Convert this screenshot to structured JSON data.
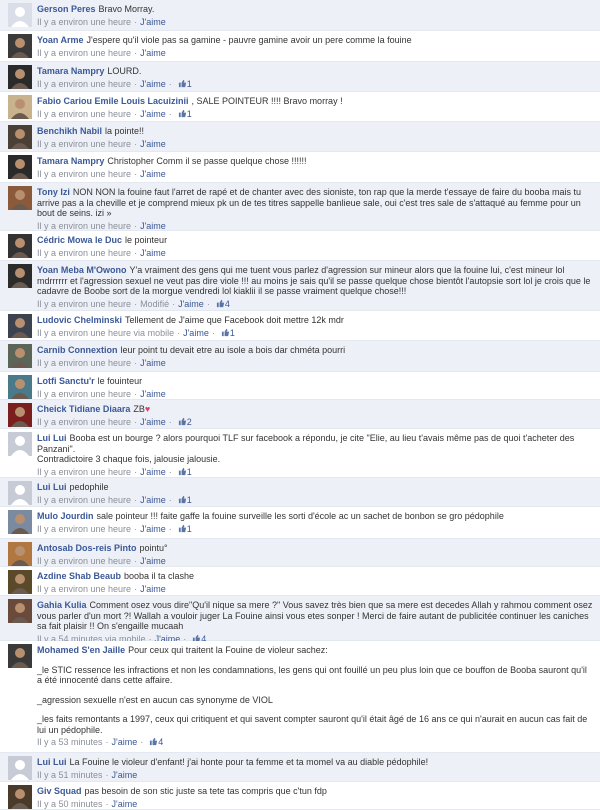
{
  "ui": {
    "like": "J'aime",
    "dot": "·"
  },
  "comments": [
    {
      "name": "Gerson Peres",
      "text": "Bravo Morray.",
      "time": "Il y a environ une heure",
      "avatar": "#d9dee8"
    },
    {
      "name": "Yoan Arme",
      "text": "J'espere qu'il viole pas sa gamine - pauvre gamine avoir un pere comme la fouine",
      "time": "Il y a environ une heure",
      "avatar": "#3a3a3a"
    },
    {
      "name": "Tamara Nampry",
      "text": "LOURD.",
      "time": "Il y a environ une heure",
      "likes": "1",
      "avatar": "#2a2a2a"
    },
    {
      "name": "Fabio Cariou Emile Louis Lacuizinii",
      "text": ", SALE POINTEUR !!!! Bravo morray !",
      "time": "Il y a environ une heure",
      "likes": "1",
      "avatar": "#c9b28e"
    },
    {
      "name": "Benchikh Nabil",
      "text": "la pointe!!",
      "time": "Il y a environ une heure",
      "avatar": "#4a4036"
    },
    {
      "name": "Tamara Nampry",
      "text": "Christopher Comm il se passe quelque chose !!!!!!",
      "time": "Il y a environ une heure",
      "avatar": "#2a2a2a"
    },
    {
      "name": "Tony Izi",
      "text": "NON NON la fouine faut l'arret de rapé et de chanter avec des sioniste, ton rap que la merde t'essaye de faire du booba mais tu arrive pas a la cheville et je comprend mieux pk un de tes titres sappelle banlieue sale, oui c'est tres sale de s'attaqué au femme pour un bout de seins. izi »",
      "time": "Il y a environ une heure",
      "avatar": "#8a5a3a"
    },
    {
      "name": "Cédric Mowa le Duc",
      "text": "le pointeur",
      "time": "Il y a environ une heure",
      "avatar": "#333333"
    },
    {
      "name": "Yoan Meba M'Owono",
      "text": "Y'a vraiment des gens qui me tuent vous parlez d'agression sur mineur alors que la fouine lui, c'est mineur lol mdrrrrrr et l'agression sexuel ne veut pas dire viole !!! au moins je sais qu'il se passe quelque chose bientôt l'autopsie sort lol je crois que le cadavre de Boobe sort de la morgue vendredi lol kiaklii il se passe vraiment quelque chose!!!",
      "time": "Il y a environ une heure",
      "modified": "Modifié",
      "likes": "4",
      "avatar": "#2c2c2c"
    },
    {
      "name": "Ludovic Chelminski",
      "text": "Tellement de J'aime que Facebook doit mettre 12k mdr",
      "time": "Il y a environ une heure via mobile",
      "likes": "1",
      "avatar": "#3c4350"
    },
    {
      "name": "Carnib Connextion",
      "text": "leur point tu devait etre au isole a bois dar chméta pourri",
      "time": "Il y a environ une heure",
      "avatar": "#5c6658"
    },
    {
      "name": "Lotfi Sanctu'r",
      "text": "le fouinteur",
      "time": "Il y a environ une heure",
      "avatar": "#4a7a8a"
    },
    {
      "name": "Cheick Tidiane Diaara",
      "text": "ZB",
      "heart": "♥",
      "time": "Il y a environ une heure",
      "likes": "2",
      "avatar": "#7a1e1e"
    },
    {
      "name": "Lui Lui",
      "text": "Booba est un bourge ? alors pourquoi TLF sur facebook a répondu, je cite \"Elie, au lieu t'avais même pas de quoi t'acheter des Panzani\".",
      "text2": "Contradictoire 3 chaque fois, jalousie jalousie.",
      "time": "Il y a environ une heure",
      "likes": "1",
      "avatar": "#c6cbd6"
    },
    {
      "name": "Lui Lui",
      "text": "pedophile",
      "time": "Il y a environ une heure",
      "likes": "1",
      "avatar": "#c6cbd6"
    },
    {
      "name": "Mulo Jourdin",
      "text": "sale pointeur !!! faite gaffe la fouine surveille les sorti d'école ac un sachet de bonbon se gro pédophile",
      "time": "Il y a environ une heure",
      "likes": "1",
      "avatar": "#7a8aa0"
    },
    {
      "name": "Antosab Dos-reis Pinto",
      "text": "pointu°",
      "time": "Il y a environ une heure",
      "avatar": "#b07840"
    },
    {
      "name": "Azdine Shab Beaub",
      "text": "booba il ta clashe",
      "time": "Il y a environ une heure",
      "avatar": "#5a4a2a"
    },
    {
      "name": "Gahia Kulia",
      "text": "Comment osez vous dire\"Qu'il nique sa mere ?\" Vous savez très bien que sa mere est decedes Allah y rahmou comment osez vous parler d'un mort ?! Wallah a vouloir juger La Fouine ainsi vous etes sonper ! Merci de faire autant de publicitée continuer les caniches sa fait plaisir !! On s'engaille mucaah",
      "time": "Il y a 54 minutes via mobile",
      "likes": "4",
      "avatar": "#6a4a3a"
    },
    {
      "name": "Mohamed S'en Jaille",
      "text": "Pour ceux qui traitent la Fouine de violeur sachez:",
      "p2": "_le STIC ressence les infractions et non les condamnations, les gens qui ont fouillé un peu plus loin que ce bouffon de Booba sauront qu'il a été innocenté dans cette affaire.",
      "p3": "_agression sexuelle n'est en aucun cas synonyme de VIOL",
      "p4": "_les faits remontants a 1997, ceux qui critiquent et qui savent compter sauront qu'il était âgé de 16 ans ce qui n'aurait en aucun cas fait de lui un pédophile.",
      "time": "Il y a 53 minutes",
      "likes": "4",
      "avatar": "#3a3a3a"
    },
    {
      "name": "Lui Lui",
      "text": "La Fouine le violeur d'enfant! j'ai honte pour ta femme et ta momel va au diable pédophile!",
      "time": "Il y a 51 minutes",
      "avatar": "#c6cbd6"
    },
    {
      "name": "Giv Squad",
      "text": "pas besoin de son stic juste sa tete tas compris que c'tun fdp",
      "time": "Il y a 50 minutes",
      "avatar": "#4a3a2a"
    }
  ]
}
